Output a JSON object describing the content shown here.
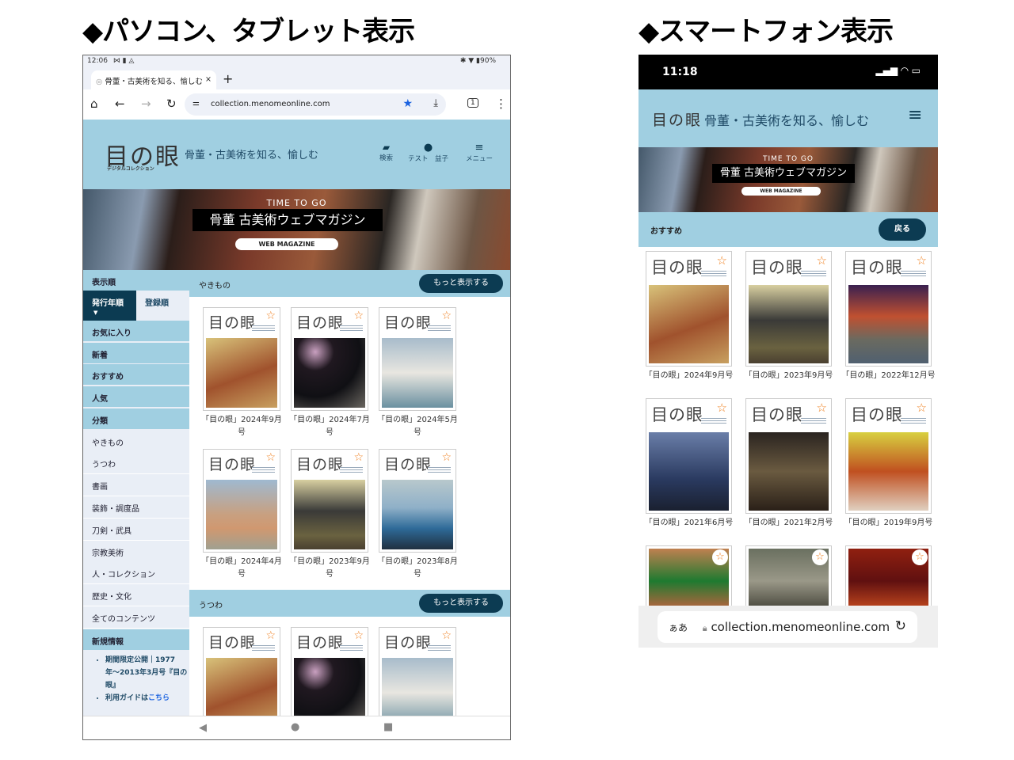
{
  "headings": {
    "tablet": "◆パソコン、タブレット表示",
    "phone": "◆スマートフォン表示"
  },
  "tablet": {
    "status": {
      "time": "12:06",
      "icons": "⋈ ▮ ◬",
      "right": "✱ ▼ ▮90%"
    },
    "tab": {
      "title": "骨董・古美術を知る、愉しむ",
      "close": "×",
      "new": "+"
    },
    "toolbar": {
      "url": "collection.menomeonline.com",
      "tab_count": "1"
    },
    "site": {
      "logo": "目の眼",
      "logo_sub": "デジタルコレクション",
      "tagline": "骨董・古美術を知る、愉しむ",
      "search": "検索",
      "user": "テスト　益子",
      "menu": "メニュー"
    },
    "banner": {
      "kicker": "TIME TO GO",
      "title": "骨董 古美術ウェブマガジン",
      "badge": "WEB MAGAZINE"
    },
    "sidebar": {
      "sort_label": "表示順",
      "sort_active": "発行年順",
      "sort_other": "登録順",
      "top_items": [
        "お気に入り",
        "新着",
        "おすすめ",
        "人気",
        "分類"
      ],
      "categories": [
        "やきもの",
        "うつわ",
        "書画",
        "装飾・調度品",
        "刀剣・武具",
        "宗教美術",
        "人・コレクション",
        "歴史・文化",
        "全てのコンテンツ"
      ],
      "news_label": "新規情報",
      "news": [
        "期間限定公開｜1977年〜2013年3月号『目の眼』",
        "利用ガイドは"
      ],
      "news_link": "こちら"
    },
    "sections": [
      {
        "title": "やきもの",
        "more": "もっと表示する",
        "items": [
          "「目の眼」2024年9月号",
          "「目の眼」2024年7月号",
          "「目の眼」2024年5月号",
          "「目の眼」2024年4月号",
          "「目の眼」2023年9月号",
          "「目の眼」2023年8月号"
        ]
      },
      {
        "title": "うつわ",
        "more": "もっと表示する",
        "items": [
          "",
          "",
          ""
        ]
      }
    ]
  },
  "phone": {
    "status": {
      "time": "11:18"
    },
    "site": {
      "logo": "目の眼",
      "tagline": "骨董・古美術を知る、愉しむ"
    },
    "banner": {
      "kicker": "TIME TO GO",
      "title": "骨董 古美術ウェブマガジン",
      "badge": "WEB MAGAZINE"
    },
    "section": {
      "title": "おすすめ",
      "back": "戻る"
    },
    "items": [
      "「目の眼」2024年9月号",
      "「目の眼」2023年9月号",
      "「目の眼」2022年12月号",
      "「目の眼」2021年6月号",
      "「目の眼」2021年2月号",
      "「目の眼」2019年9月号",
      "",
      "",
      ""
    ],
    "urlbar": {
      "aa": "ぁあ",
      "url": "collection.menomeonline.com"
    }
  },
  "colors": {
    "header": "#a0cfe1",
    "button": "#0c3b52",
    "next": "#6fdca0",
    "star": "#f08020"
  }
}
